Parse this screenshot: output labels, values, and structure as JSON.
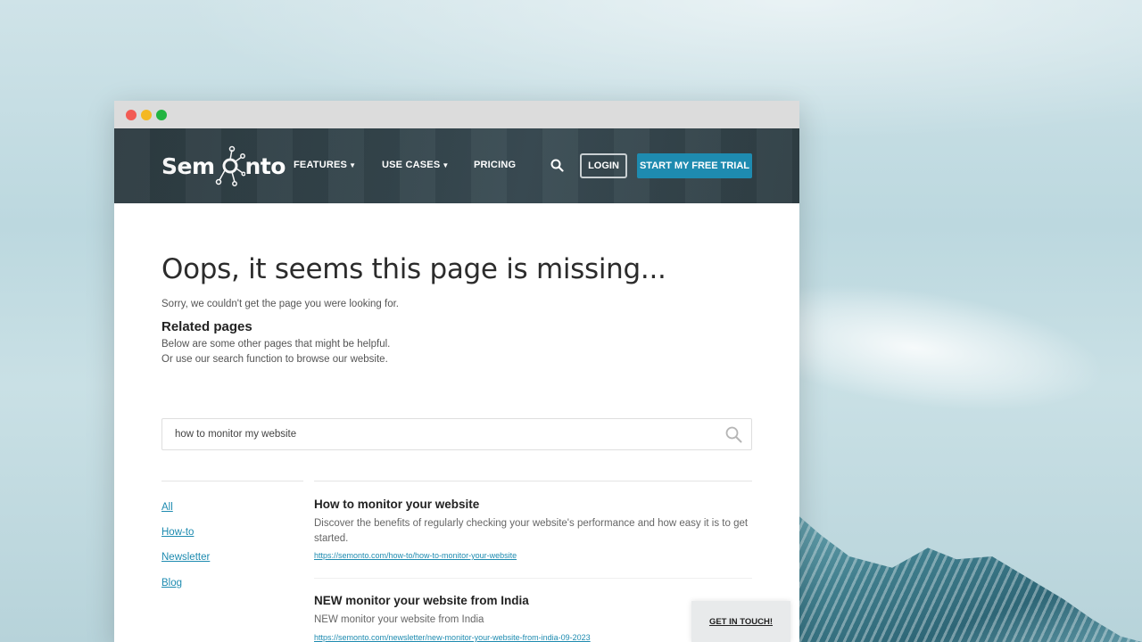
{
  "brand": {
    "logo_left": "Sem",
    "logo_right": "nto"
  },
  "nav": {
    "features_label": "FEATURES",
    "use_cases_label": "USE CASES",
    "pricing_label": "PRICING",
    "login_label": "LOGIN",
    "trial_label": "START MY FREE TRIAL"
  },
  "error": {
    "heading": "Oops, it seems this page is missing...",
    "sorry_text": "Sorry, we couldn't get the page you were looking for.",
    "related_title": "Related pages",
    "related_line1": "Below are some other pages that might be helpful.",
    "related_line2": "Or use our search function to browse our website."
  },
  "search": {
    "value": "how to monitor my website"
  },
  "filters": [
    {
      "label": "All"
    },
    {
      "label": "How-to"
    },
    {
      "label": "Newsletter"
    },
    {
      "label": "Blog"
    }
  ],
  "results": [
    {
      "title": "How to monitor your website",
      "description": "Discover the benefits of regularly checking your website's performance and how easy it is to get started.",
      "url": "https://semonto.com/how-to/how-to-monitor-your-website"
    },
    {
      "title": "NEW monitor your website from India",
      "description": "NEW monitor your website from India",
      "url": "https://semonto.com/newsletter/new-monitor-your-website-from-india-09-2023"
    }
  ],
  "cta": {
    "get_in_touch": "GET IN TOUCH!"
  },
  "colors": {
    "accent": "#1e8bb0",
    "nav_bg": "#34454c",
    "window_red": "#f25b54",
    "window_yellow": "#f4b823",
    "window_green": "#22b441"
  },
  "icons": [
    "search-icon",
    "logo-network-icon",
    "caret-down-icon"
  ]
}
